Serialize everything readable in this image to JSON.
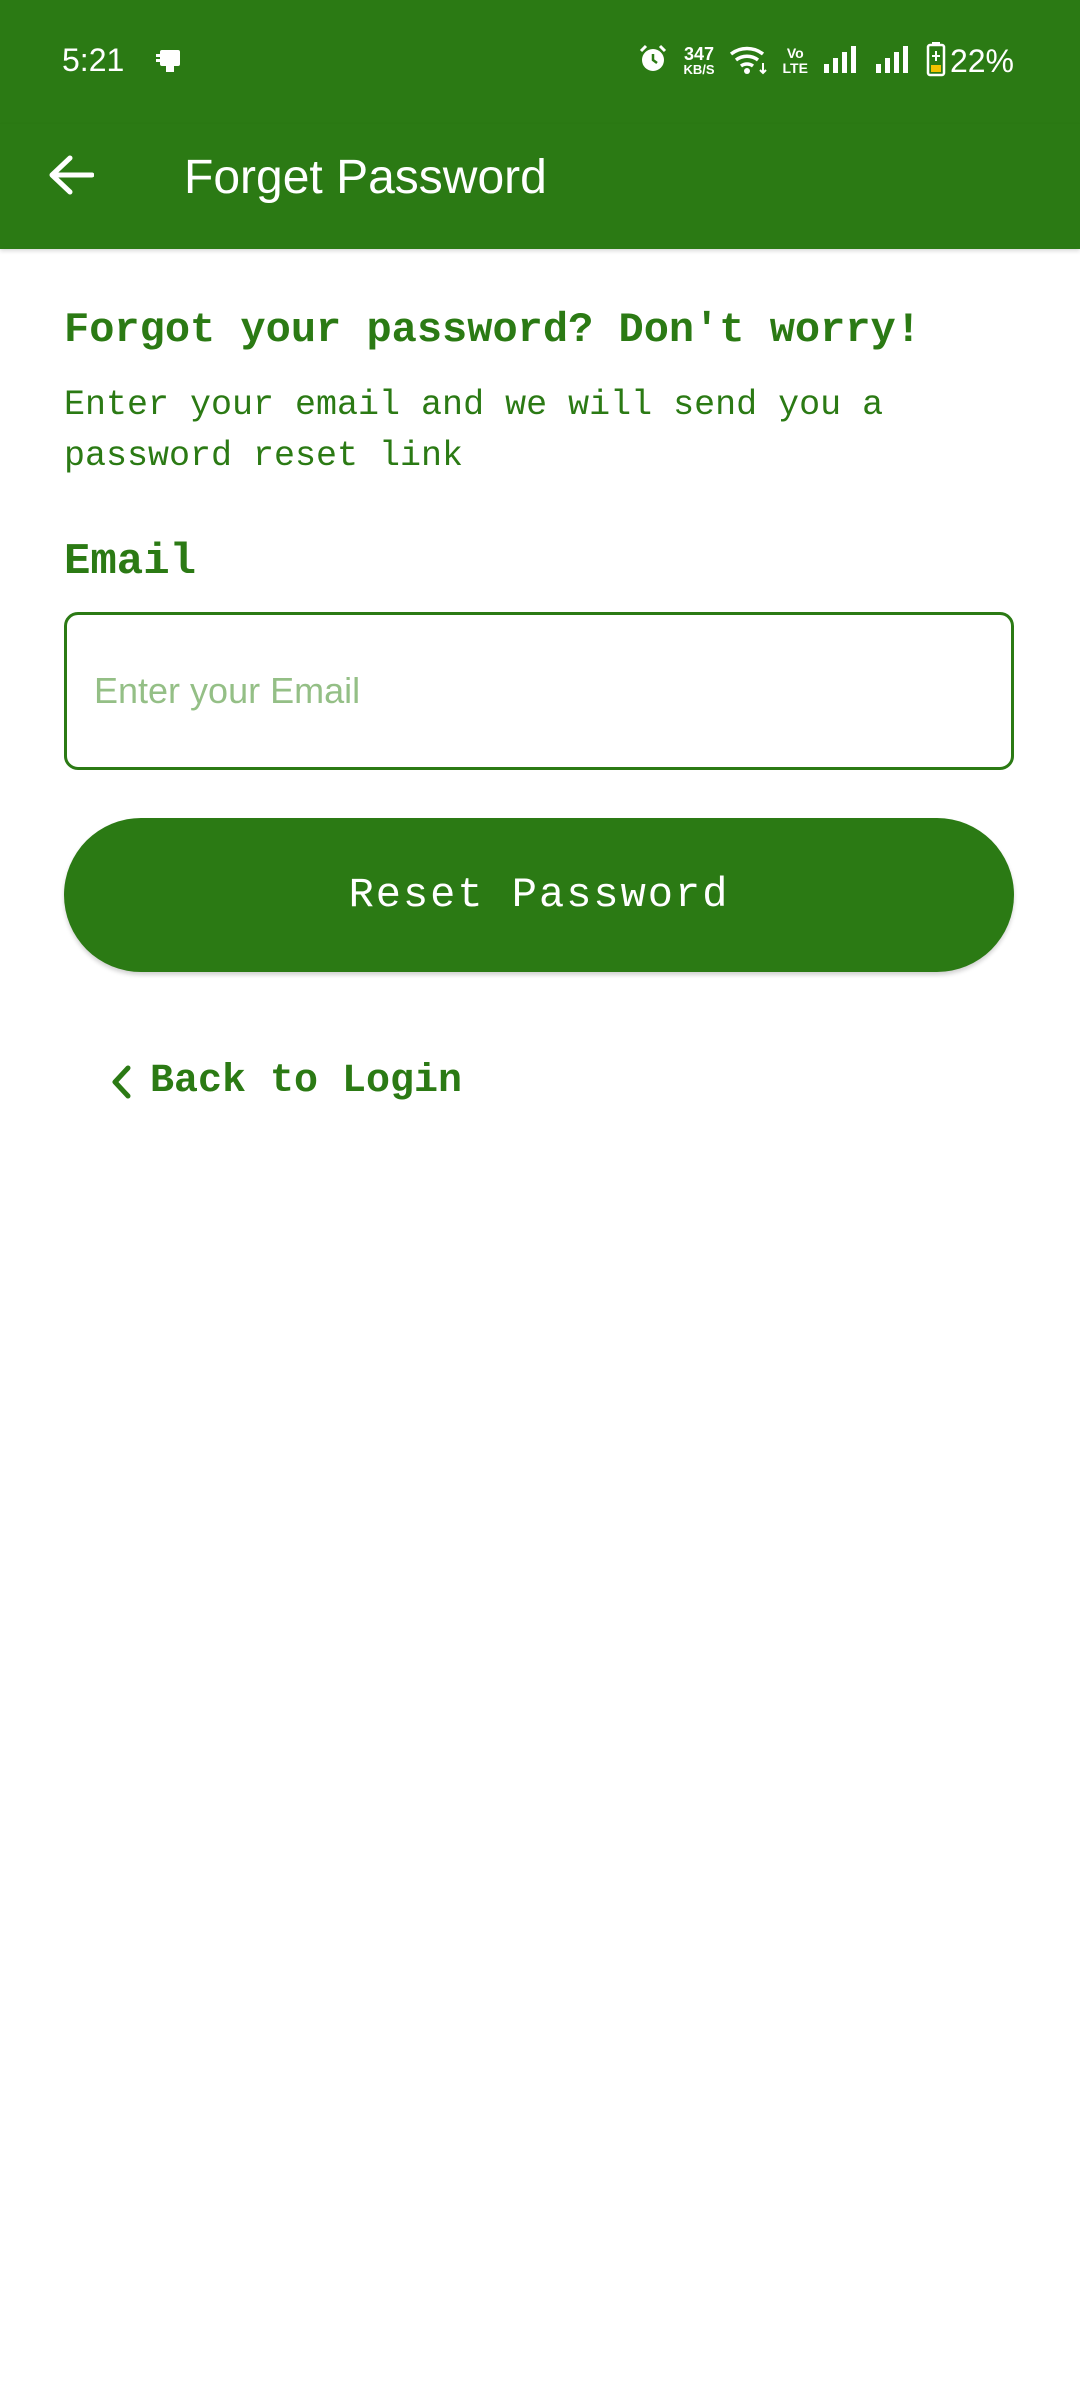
{
  "status_bar": {
    "time": "5:21",
    "net_speed_value": "347",
    "net_speed_unit": "KB/S",
    "volte_top": "Vo",
    "volte_bottom": "LTE",
    "battery": "22%",
    "icons": [
      "notification-icon",
      "alarm-icon",
      "wifi-icon",
      "signal-icon",
      "signal-icon",
      "battery-icon"
    ]
  },
  "app_bar": {
    "title": "Forget Password",
    "back_icon": "arrow-left-icon"
  },
  "content": {
    "heading": "Forgot your password? Don't worry!",
    "subtext": "Enter your email and we will send you a password reset link",
    "email_label": "Email",
    "email_value": "",
    "email_placeholder": "Enter your Email",
    "reset_button": "Reset Password",
    "back_to_login": "Back to Login"
  },
  "colors": {
    "primary": "#2b7a14",
    "placeholder": "#94bf86",
    "background": "#ffffff"
  }
}
